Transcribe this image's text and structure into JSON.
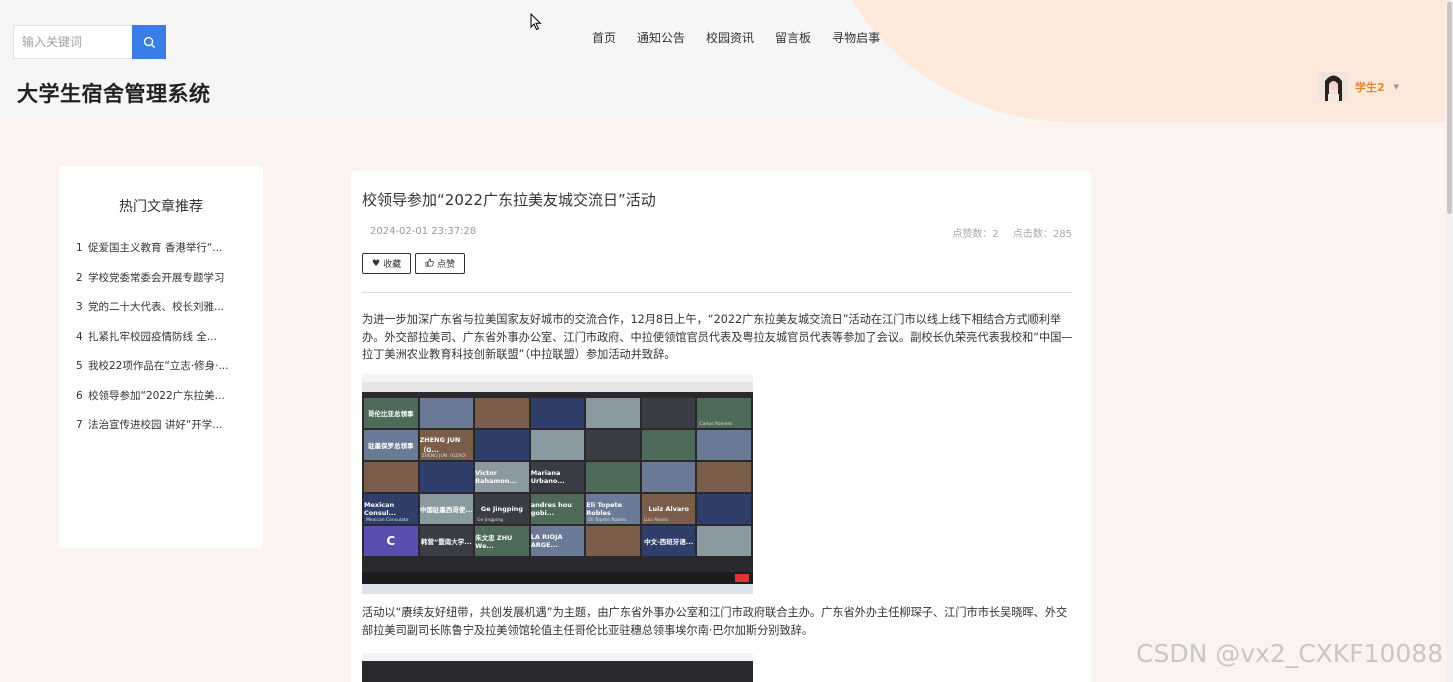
{
  "search": {
    "placeholder": "输入关键词"
  },
  "site": {
    "title": "大学生宿舍管理系统"
  },
  "nav": {
    "items": [
      {
        "label": "首页"
      },
      {
        "label": "通知公告"
      },
      {
        "label": "校园资讯"
      },
      {
        "label": "留言板"
      },
      {
        "label": "寻物启事"
      }
    ]
  },
  "user": {
    "name": "学生2"
  },
  "sidebar": {
    "title": "热门文章推荐",
    "items": [
      {
        "num": "1",
        "label": "促爱国主义教育 香港举行“..."
      },
      {
        "num": "2",
        "label": "学校党委常委会开展专题学习"
      },
      {
        "num": "3",
        "label": "党的二十大代表、校长刘雅..."
      },
      {
        "num": "4",
        "label": "扎紧扎牢校园疫情防线 全..."
      },
      {
        "num": "5",
        "label": "我校22项作品在“立志·修身·..."
      },
      {
        "num": "6",
        "label": "校领导参加“2022广东拉美..."
      },
      {
        "num": "7",
        "label": "法治宣传进校园 讲好“开学..."
      }
    ]
  },
  "article": {
    "title": "校领导参加“2022广东拉美友城交流日”活动",
    "date": "2024-02-01 23:37:28",
    "likes_label": "点赞数：2",
    "clicks_label": "点击数：285",
    "favorite_label": "收藏",
    "like_label": "点赞",
    "paragraph1": "为进一步加深广东省与拉美国家友好城市的交流合作，12月8日上午，“2022广东拉美友城交流日”活动在江门市以线上线下相结合方式顺利举办。外交部拉美司、广东省外事办公室、江门市政府、中拉使领馆官员代表及粤拉友城官员代表等参加了会议。副校长仇荣亮代表我校和“中国—拉丁美洲农业教育科技创新联盟”（中拉联盟）参加活动并致辞。",
    "paragraph2": "活动以“赓续友好纽带，共创发展机遇”为主题，由广东省外事办公室和江门市政府联合主办。广东省外办主任柳琛子、江门市市长吴晓晖、外交部拉美司副司长陈鲁宁及拉美领馆轮值主任哥伦比亚驻穗总领事埃尔南·巴尔加斯分别致辞。",
    "video_tiles": [
      {
        "text": "哥伦比亚总领事",
        "cap": ""
      },
      {
        "text": "",
        "cap": ""
      },
      {
        "text": "",
        "cap": ""
      },
      {
        "text": "",
        "cap": ""
      },
      {
        "text": "",
        "cap": ""
      },
      {
        "text": "",
        "cap": ""
      },
      {
        "text": "",
        "cap": "Carlos Romero"
      },
      {
        "text": "驻墨保罗总领事",
        "cap": ""
      },
      {
        "text": "ZHENG JUN（G...",
        "cap": "ZHENG JUN（GZAO）"
      },
      {
        "text": "",
        "cap": ""
      },
      {
        "text": "",
        "cap": ""
      },
      {
        "text": "",
        "cap": ""
      },
      {
        "text": "",
        "cap": ""
      },
      {
        "text": "",
        "cap": ""
      },
      {
        "text": "",
        "cap": ""
      },
      {
        "text": "",
        "cap": ""
      },
      {
        "text": "Victor Bahamon...",
        "cap": ""
      },
      {
        "text": "Mariana Urbano...",
        "cap": ""
      },
      {
        "text": "",
        "cap": ""
      },
      {
        "text": "",
        "cap": ""
      },
      {
        "text": "",
        "cap": ""
      },
      {
        "text": "Mexican Consul...",
        "cap": "Mexican Consulate"
      },
      {
        "text": "中国驻墨西哥使...",
        "cap": ""
      },
      {
        "text": "Ge Jingping",
        "cap": "Ge Jingping"
      },
      {
        "text": "andres hou gobi...",
        "cap": ""
      },
      {
        "text": "Eli Topete Robles",
        "cap": "Eli Topete Robles"
      },
      {
        "text": "Luiz Alvaro",
        "cap": "Luiz Alvaro"
      },
      {
        "text": "",
        "cap": ""
      },
      {
        "text": "C",
        "cap": ""
      },
      {
        "text": "韩营“暨南大学...",
        "cap": ""
      },
      {
        "text": "朱文忠 ZHU We...",
        "cap": ""
      },
      {
        "text": "LA RIOJA ARGE...",
        "cap": ""
      },
      {
        "text": "",
        "cap": ""
      },
      {
        "text": "中文-西班牙语...",
        "cap": ""
      },
      {
        "text": "",
        "cap": ""
      }
    ]
  },
  "watermark": "CSDN @vx2_CXKF10088"
}
